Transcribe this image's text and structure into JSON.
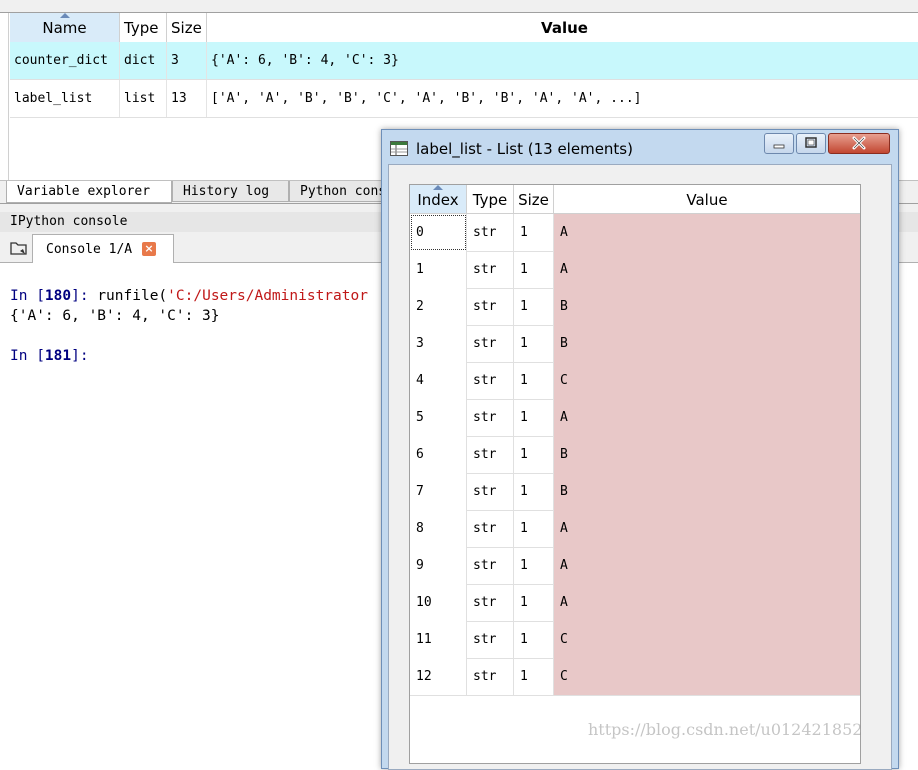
{
  "variable_explorer": {
    "columns": [
      "Name",
      "Type",
      "Size",
      "Value"
    ],
    "rows": [
      {
        "name": "counter_dict",
        "type": "dict",
        "size": "3",
        "value": "{'A': 6, 'B': 4, 'C': 3}"
      },
      {
        "name": "label_list",
        "type": "list",
        "size": "13",
        "value": "['A', 'A', 'B', 'B', 'C', 'A', 'B', 'B', 'A', 'A', ...]"
      }
    ],
    "selected_row_color": "#c8f8fc"
  },
  "bottom_tabs": [
    "Variable explorer",
    "History log",
    "Python console"
  ],
  "ipython": {
    "title": "IPython console",
    "tab_label": "Console 1/A",
    "lines": {
      "in180_prompt": "In [",
      "in180_num": "180",
      "in180_close": "]: ",
      "in180_cmd": "runfile(",
      "in180_arg": "'C:/Users/Administrator",
      "output": "{'A': 6, 'B': 4, 'C': 3}",
      "in181_prompt": "In [",
      "in181_num": "181",
      "in181_close": "]:"
    }
  },
  "popup": {
    "title": "label_list - List (13 elements)",
    "columns": [
      "Index",
      "Type",
      "Size",
      "Value"
    ],
    "value_bg": "#e8c8c8",
    "rows": [
      {
        "index": "0",
        "type": "str",
        "size": "1",
        "value": "A"
      },
      {
        "index": "1",
        "type": "str",
        "size": "1",
        "value": "A"
      },
      {
        "index": "2",
        "type": "str",
        "size": "1",
        "value": "B"
      },
      {
        "index": "3",
        "type": "str",
        "size": "1",
        "value": "B"
      },
      {
        "index": "4",
        "type": "str",
        "size": "1",
        "value": "C"
      },
      {
        "index": "5",
        "type": "str",
        "size": "1",
        "value": "A"
      },
      {
        "index": "6",
        "type": "str",
        "size": "1",
        "value": "B"
      },
      {
        "index": "7",
        "type": "str",
        "size": "1",
        "value": "B"
      },
      {
        "index": "8",
        "type": "str",
        "size": "1",
        "value": "A"
      },
      {
        "index": "9",
        "type": "str",
        "size": "1",
        "value": "A"
      },
      {
        "index": "10",
        "type": "str",
        "size": "1",
        "value": "A"
      },
      {
        "index": "11",
        "type": "str",
        "size": "1",
        "value": "C"
      },
      {
        "index": "12",
        "type": "str",
        "size": "1",
        "value": "C"
      }
    ]
  },
  "watermark": "https://blog.csdn.net/u012421852"
}
